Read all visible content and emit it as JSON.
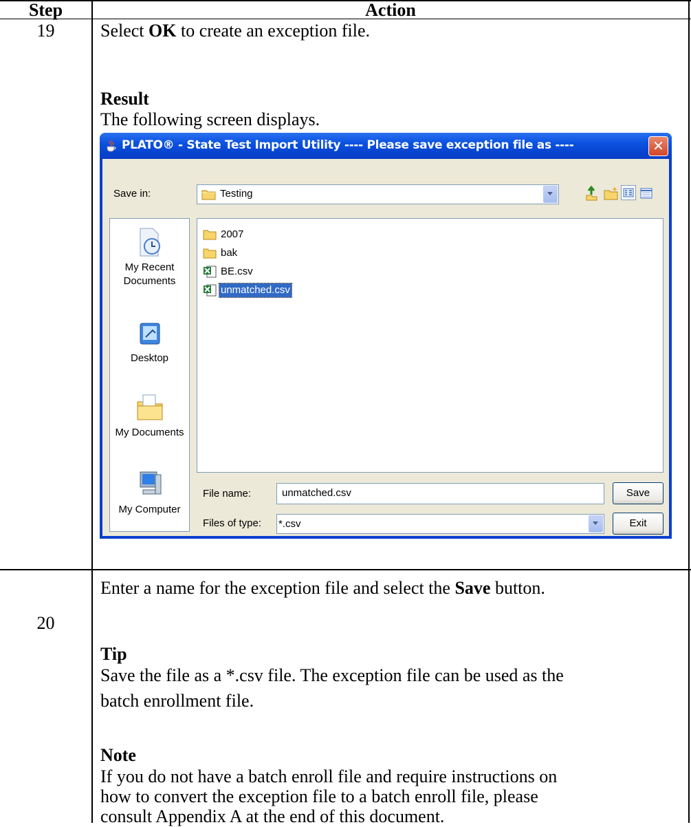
{
  "table": {
    "header_step": "Step",
    "header_action": "Action",
    "row1_step": "19",
    "row1_line1_pre": "Select ",
    "row1_line1_bold": "OK",
    "row1_line1_post": " to create an exception file.",
    "row1_result_heading": "Result",
    "row1_result_text": "The following screen displays.",
    "row2_step": "20",
    "row2_line1_pre": "Enter a name for the exception file and select the ",
    "row2_line1_bold": "Save",
    "row2_line1_post": " button.",
    "row2_tip_heading": "Tip",
    "row2_tip_line1": "Save the file as a *.csv file. The exception file can be used as the",
    "row2_tip_line2": "batch enrollment file.",
    "row2_note_heading": "Note",
    "row2_note_line1": "If you do not have a batch enroll file and require instructions on",
    "row2_note_line2": "how to convert the exception file to a batch enroll file, please",
    "row2_note_line3": "consult Appendix A at the end of this document."
  },
  "dialog": {
    "title": "PLATO® - State Test Import Utility ---- Please save exception file as ----",
    "save_in_label": "Save in:",
    "save_in_value": "Testing",
    "places": [
      {
        "label_line1": "My Recent",
        "label_line2": "Documents",
        "icon": "recent-documents-icon"
      },
      {
        "label_line1": "Desktop",
        "label_line2": "",
        "icon": "desktop-icon"
      },
      {
        "label_line1": "My Documents",
        "label_line2": "",
        "icon": "my-documents-icon"
      },
      {
        "label_line1": "My Computer",
        "label_line2": "",
        "icon": "my-computer-icon"
      }
    ],
    "files": [
      {
        "name": "2007",
        "type": "folder"
      },
      {
        "name": "bak",
        "type": "folder"
      },
      {
        "name": "BE.csv",
        "type": "excel"
      },
      {
        "name": "unmatched.csv",
        "type": "excel",
        "selected": true
      }
    ],
    "file_name_label": "File name:",
    "file_name_value": "unmatched.csv",
    "files_of_type_label": "Files of type:",
    "files_of_type_value": "*.csv",
    "save_button": "Save",
    "exit_button": "Exit",
    "colors": {
      "title_bar": "#0b52e0",
      "dialog_body": "#ece9d8",
      "selection": "#316ac5"
    }
  }
}
